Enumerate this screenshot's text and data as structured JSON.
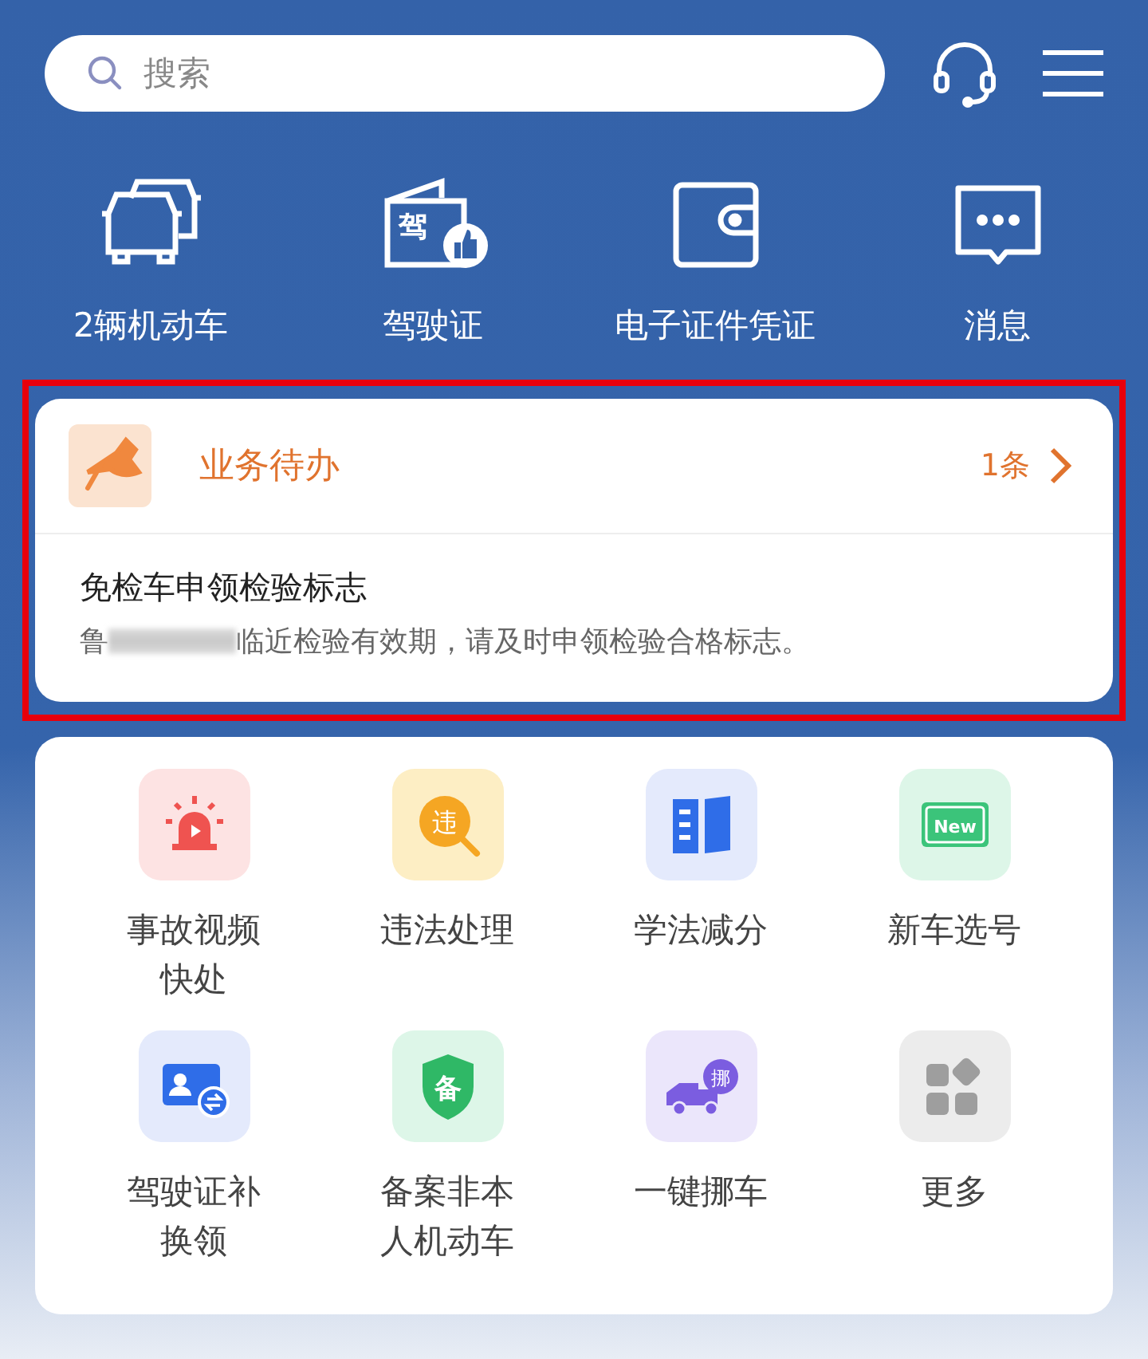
{
  "search": {
    "placeholder": "搜索"
  },
  "top_nav": [
    {
      "kind": "cars",
      "label": "2辆机动车"
    },
    {
      "kind": "license",
      "label": "驾驶证",
      "icon_text": "驾"
    },
    {
      "kind": "wallet",
      "label": "电子证件凭证"
    },
    {
      "kind": "message",
      "label": "消息"
    }
  ],
  "todo": {
    "highlighted": true,
    "title": "业务待办",
    "count": "1条",
    "item_title": "免检车申领检验标志",
    "item_prefix": "鲁",
    "redacted": true,
    "item_text": "临近检验有效期，请及时申领检验合格标志。"
  },
  "services": [
    {
      "kind": "alarm",
      "label": "事故视频快处"
    },
    {
      "kind": "violation",
      "label": "违法处理",
      "icon_text": "违"
    },
    {
      "kind": "book",
      "label": "学法减分"
    },
    {
      "kind": "plate",
      "label": "新车选号",
      "icon_text": "New"
    },
    {
      "kind": "card",
      "label": "驾驶证补换领"
    },
    {
      "kind": "shield",
      "label": "备案非本人机动车",
      "icon_text": "备"
    },
    {
      "kind": "truck",
      "label": "一键挪车",
      "icon_text": "挪"
    },
    {
      "kind": "more",
      "label": "更多"
    }
  ]
}
